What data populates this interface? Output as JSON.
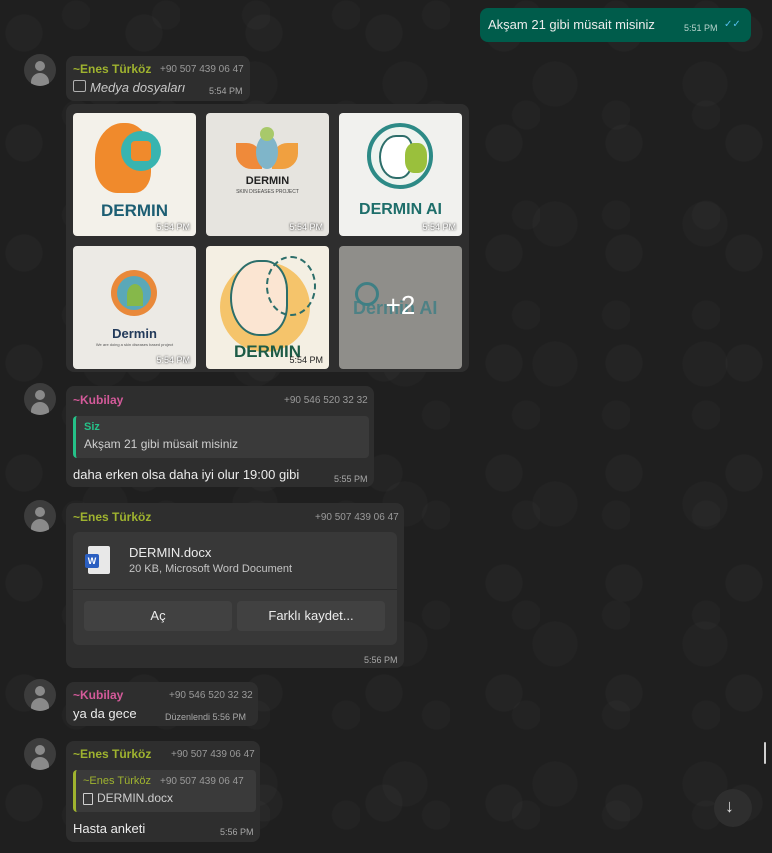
{
  "outgoing": {
    "text": "Akşam 21 gibi müsait misiniz",
    "time": "5:51 PM"
  },
  "media_msg": {
    "sender": "~Enes Türköz",
    "phone": "+90 507 439 06 47",
    "label": "Medya dosyaları",
    "time": "5:54 PM",
    "thumbs": [
      {
        "brand": "DERMIN",
        "time": "5:54 PM"
      },
      {
        "brand": "DERMIN",
        "sub": "SKIN DISEASES PROJECT",
        "time": "5:54 PM"
      },
      {
        "brand": "DERMIN AI",
        "time": "5:54 PM"
      },
      {
        "brand": "Dermin",
        "sub": "We are doing a skin diseases based project",
        "time": "5:54 PM"
      },
      {
        "brand": "DERMIN",
        "time": "5:54 PM"
      },
      {
        "brand": "Dermin AI",
        "more": "+2"
      }
    ]
  },
  "kubilay_reply": {
    "sender": "~Kubilay",
    "phone": "+90 546 520 32 32",
    "quote_author": "Siz",
    "quote_text": "Akşam 21 gibi müsait misiniz",
    "text": "daha erken olsa daha iyi olur 19:00 gibi",
    "time": "5:55 PM"
  },
  "doc_msg": {
    "sender": "~Enes Türköz",
    "phone": "+90 507 439 06 47",
    "file_name": "DERMIN.docx",
    "file_info": "20 KB, Microsoft Word Document",
    "open_label": "Aç",
    "save_label": "Farklı kaydet...",
    "time": "5:56 PM"
  },
  "kubilay_msg2": {
    "sender": "~Kubilay",
    "phone": "+90 546 520 32 32",
    "text": "ya da gece",
    "edited_time": "Düzenlendi 5:56 PM"
  },
  "enes_reply": {
    "sender": "~Enes Türköz",
    "phone": "+90 507 439 06 47",
    "quote_author": "~Enes Türköz",
    "quote_phone": "+90 507 439 06 47",
    "quote_file": "DERMIN.docx",
    "text": "Hasta anketi",
    "time": "5:56 PM"
  },
  "colors": {
    "outgoing_bg": "#005c4b",
    "incoming_bg": "#2e2e2e",
    "green_name": "#9fb32f",
    "pink_name": "#d45a9a"
  }
}
